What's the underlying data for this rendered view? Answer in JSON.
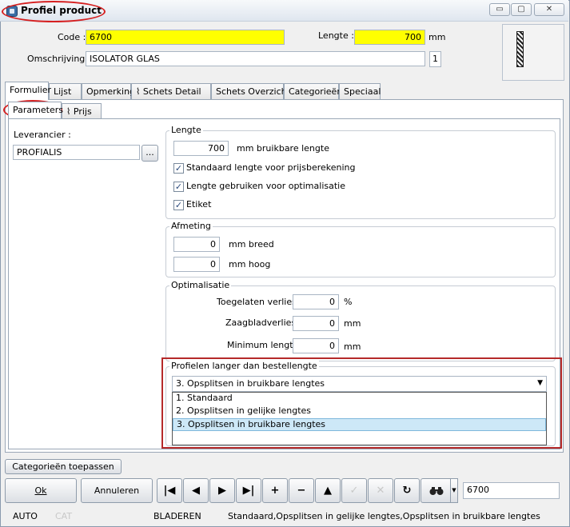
{
  "window": {
    "title": "Profiel product"
  },
  "window_controls": {
    "minimize": "▭",
    "maximize": "▢",
    "close": "✕"
  },
  "header": {
    "code_label": "Code :",
    "code_value": "6700",
    "length_label": "Lengte :",
    "length_value": "700",
    "length_unit": "mm",
    "description_label": "Omschrijving :",
    "description_value": "ISOLATOR GLAS",
    "description_count": "1"
  },
  "tabs": [
    "Formulier",
    "Lijst",
    "Opmerking",
    "Schets Detail",
    "Schets Overzicht",
    "Categorieën",
    "Speciaal"
  ],
  "subtabs": [
    "Parameters",
    "Prijs"
  ],
  "supplier": {
    "label": "Leverancier :",
    "value": "PROFIALIS",
    "browse": "..."
  },
  "lengte_group": {
    "title": "Lengte",
    "value": "700",
    "value_suffix": "mm bruikbare lengte",
    "check1": "Standaard lengte voor prijsberekening",
    "check2": "Lengte gebruiken voor optimalisatie",
    "check3": "Etiket",
    "check_mark": "✓"
  },
  "afmeting_group": {
    "title": "Afmeting",
    "breed_value": "0",
    "breed_label": "mm breed",
    "hoog_value": "0",
    "hoog_label": "mm hoog"
  },
  "optimalisatie_group": {
    "title": "Optimalisatie",
    "loss_label": "Toegelaten verlies :",
    "loss_value": "0",
    "loss_unit": "%",
    "saw_label": "Zaagbladverlies :",
    "saw_value": "0",
    "saw_unit": "mm",
    "min_label": "Minimum lengte :",
    "min_value": "0",
    "min_unit": "mm"
  },
  "longer_group": {
    "title": "Profielen langer dan bestellengte",
    "selected": "3.  Opsplitsen in bruikbare lengtes",
    "options": [
      "1.  Standaard",
      "2.  Opsplitsen in gelijke lengtes",
      "3.  Opsplitsen in bruikbare lengtes"
    ]
  },
  "footer": {
    "apply_categories": "Categorieën toepassen",
    "ok": "Ok",
    "cancel": "Annuleren",
    "nav": [
      "|◀",
      "◀",
      "▶",
      "▶|",
      "+",
      "−",
      "▲",
      "✓",
      "✕",
      "↻"
    ],
    "search_value": "6700"
  },
  "statusbar": {
    "mode": "AUTO",
    "cat": "CAT",
    "state": "BLADEREN",
    "message": "Standaard,Opsplitsen in gelijke lengtes,Opsplitsen in bruikbare lengtes"
  }
}
